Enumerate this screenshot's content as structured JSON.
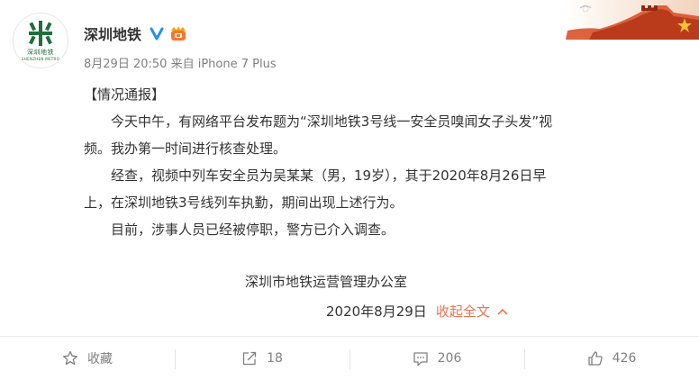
{
  "account": {
    "logo_text_cn": "深圳地铁",
    "logo_text_en": "SHENZHEN METRO",
    "username": "深圳地铁",
    "brand_color": "#1f6e3c"
  },
  "meta": {
    "time": "8月29日 20:50",
    "source_prefix": "来自",
    "source": "iPhone 7 Plus"
  },
  "post": {
    "heading": "【情况通报】",
    "lines": [
      "今天中午，有网络平台发布题为“深圳地铁3号线一安全员嗅闻女子头发”视",
      "频。我办第一时间进行核查处理。",
      "经查，视频中列车安全员为吴某某（男，19岁），其于2020年8月26日早",
      "上，在深圳地铁3号线列车执勤，期间出现上述行为。",
      "目前，涉事人员已经被停职，警方已介入调查。"
    ],
    "signer": "深圳市地铁运营管理办公室",
    "date": "2020年8月29日",
    "collapse_label": "收起全文"
  },
  "actions": {
    "favorite_label": "收藏",
    "repost_count": "18",
    "comment_count": "206",
    "like_count": "426"
  },
  "colors": {
    "accent_link": "#eb7350",
    "verified_blue": "#2a8fe6",
    "vip_orange": "#f7762b"
  },
  "icons": [
    "verified-icon",
    "vip-badge-icon",
    "chevron-up-icon",
    "star-icon",
    "repost-icon",
    "comment-icon",
    "like-icon"
  ]
}
